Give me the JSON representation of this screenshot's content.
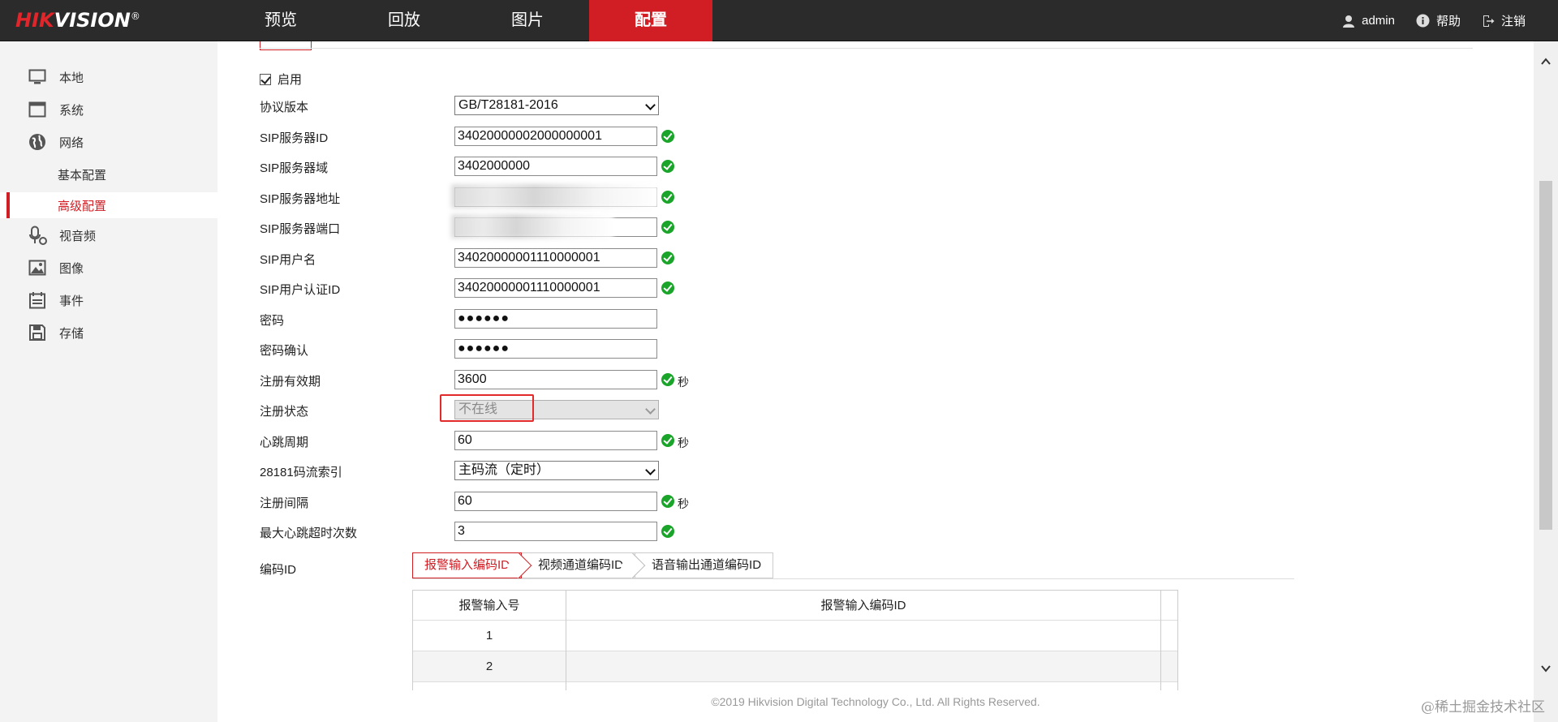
{
  "brand": {
    "logo_red": "HIK",
    "logo_white": "VISION",
    "logo_mark": "®"
  },
  "nav": [
    {
      "label": "预览",
      "active": false
    },
    {
      "label": "回放",
      "active": false
    },
    {
      "label": "图片",
      "active": false
    },
    {
      "label": "配置",
      "active": true
    }
  ],
  "top_right": {
    "user": "admin",
    "help": "帮助",
    "logout": "注销"
  },
  "sidebar": {
    "items": [
      {
        "label": "本地",
        "icon": "monitor-icon"
      },
      {
        "label": "系统",
        "icon": "window-icon"
      },
      {
        "label": "网络",
        "icon": "globe-icon"
      },
      {
        "label": "视音频",
        "icon": "mic-icon"
      },
      {
        "label": "图像",
        "icon": "image-icon"
      },
      {
        "label": "事件",
        "icon": "calendar-icon"
      },
      {
        "label": "存储",
        "icon": "floppy-icon"
      }
    ],
    "sub_items": [
      {
        "label": "基本配置",
        "active": false
      },
      {
        "label": "高级配置",
        "active": true
      }
    ]
  },
  "form": {
    "enable_label": "启用",
    "enable_checked": true,
    "fields": {
      "protocol": {
        "label": "协议版本",
        "value": "GB/T28181-2016"
      },
      "sip_server_id": {
        "label": "SIP服务器ID",
        "value": "34020000002000000001"
      },
      "sip_server_domain": {
        "label": "SIP服务器域",
        "value": "3402000000"
      },
      "sip_server_addr": {
        "label": "SIP服务器地址",
        "value": ""
      },
      "sip_server_port": {
        "label": "SIP服务器端口",
        "value": ""
      },
      "sip_user": {
        "label": "SIP用户名",
        "value": "34020000001110000001"
      },
      "sip_auth_id": {
        "label": "SIP用户认证ID",
        "value": "34020000001110000001"
      },
      "password": {
        "label": "密码",
        "value": "●●●●●●"
      },
      "password_confirm": {
        "label": "密码确认",
        "value": "●●●●●●"
      },
      "reg_validity": {
        "label": "注册有效期",
        "value": "3600",
        "unit": "秒"
      },
      "reg_status": {
        "label": "注册状态",
        "value": "不在线"
      },
      "heartbeat": {
        "label": "心跳周期",
        "value": "60",
        "unit": "秒"
      },
      "stream_index": {
        "label": "28181码流索引",
        "value": "主码流（定时）"
      },
      "reg_interval": {
        "label": "注册间隔",
        "value": "60",
        "unit": "秒"
      },
      "max_heartbeat_timeout": {
        "label": "最大心跳超时次数",
        "value": "3"
      }
    },
    "code_id_label": "编码ID",
    "code_tabs": [
      {
        "label": "报警输入编码ID",
        "active": true
      },
      {
        "label": "视频通道编码ID",
        "active": false
      },
      {
        "label": "语音输出通道编码ID",
        "active": false
      }
    ],
    "table": {
      "headers": [
        "报警输入号",
        "报警输入编码ID"
      ],
      "rows": [
        {
          "no": "1",
          "code": ""
        },
        {
          "no": "2",
          "code": ""
        }
      ]
    }
  },
  "footer": "©2019 Hikvision Digital Technology Co., Ltd. All Rights Reserved.",
  "corner_watermark": "@稀土掘金技术社区",
  "colors": {
    "brand_red": "#d01e24",
    "topbar": "#2b2b2b",
    "ok_green": "#1aa52a"
  }
}
